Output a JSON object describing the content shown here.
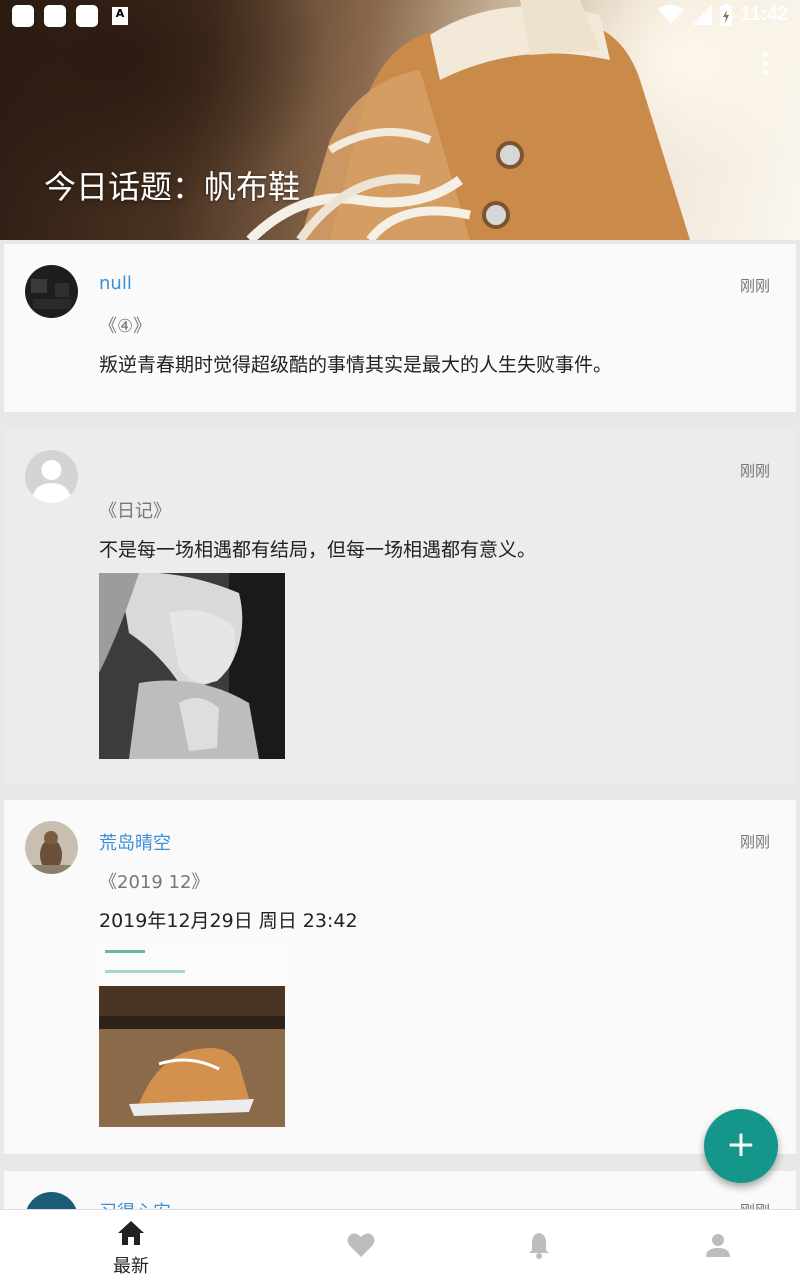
{
  "status_bar": {
    "time": "11:42",
    "notification_icons": [
      "app-notification-icon",
      "app-notification-icon",
      "app-notification-icon",
      "a-letter-icon"
    ],
    "a_letter": "A",
    "right_icons": [
      "wifi-icon",
      "cell-signal-icon",
      "battery-charging-icon"
    ]
  },
  "header": {
    "topic_title": "今日话题：帆布鞋",
    "menu_icon": "more-vert-icon"
  },
  "posts": [
    {
      "username": "null",
      "time": "刚刚",
      "title": "《④》",
      "body": "叛逆青春期时觉得超级酷的事情其实是最大的人生失败事件。",
      "has_image": false
    },
    {
      "username": "",
      "time": "刚刚",
      "title": "《日记》",
      "body": "不是每一场相遇都有结局，但每一场相遇都有意义。",
      "has_image": true
    },
    {
      "username": "荒岛晴空",
      "time": "刚刚",
      "title": "《2019 12》",
      "body": "2019年12月29日 周日 23:42",
      "has_image": true
    },
    {
      "username": "习得心安",
      "time": "刚刚"
    }
  ],
  "fab": {
    "label": "+",
    "icon": "add-icon"
  },
  "bottom_nav": {
    "items": [
      {
        "label": "最新",
        "icon": "home-icon",
        "active": true
      },
      {
        "label": "",
        "icon": "heart-icon",
        "active": false
      },
      {
        "label": "",
        "icon": "bell-icon",
        "active": false
      },
      {
        "label": "",
        "icon": "person-icon",
        "active": false
      }
    ]
  },
  "colors": {
    "accent": "#3a8fd8",
    "fab": "#14968a",
    "inactive_icon": "#bdbdbd"
  }
}
